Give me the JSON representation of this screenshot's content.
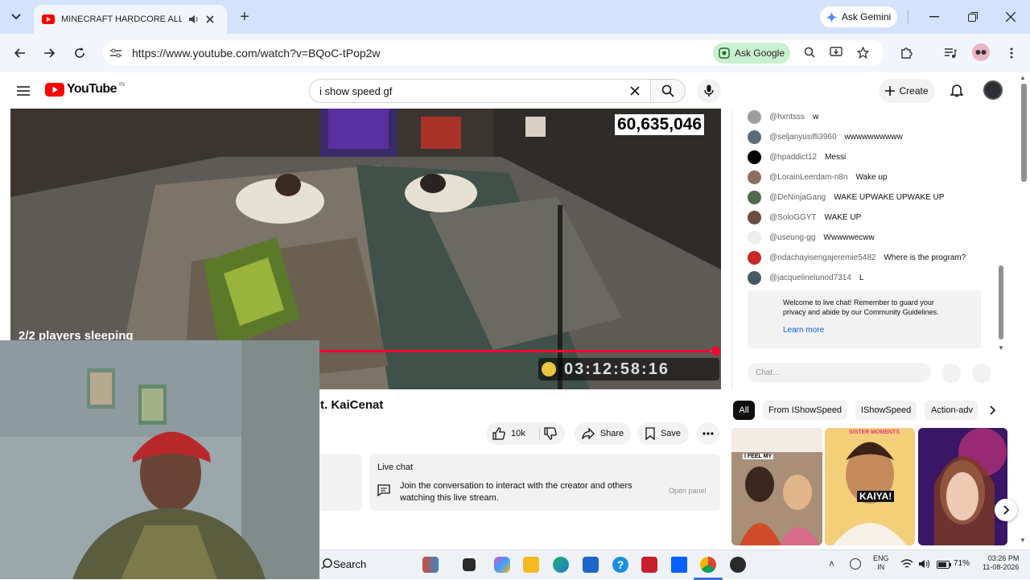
{
  "browser": {
    "tab_title": "MINECRAFT HARDCORE ALL BOS",
    "new_tab": "+",
    "ask_gemini": "Ask Gemini",
    "url": "https://www.youtube.com/watch?v=BQoC-tPop2w",
    "ask_google": "Ask Google"
  },
  "youtube": {
    "logo_text": "YouTube",
    "country_code": "IN",
    "search_value": "i show speed gf",
    "create_label": "Create"
  },
  "video": {
    "counter": "60,635,046",
    "overlay_text": "2/2 players sleeping",
    "timer": "03:12:58:16",
    "progress_fraction": 0.99,
    "title": "t. KaiCenat"
  },
  "actions": {
    "like_count": "10k",
    "share_label": "Share",
    "save_label": "Save"
  },
  "live_chat_panel": {
    "heading": "Live chat",
    "body": "Join the conversation to interact with the creator and others watching this live stream.",
    "open_button": "Open panel"
  },
  "chat": {
    "messages": [
      {
        "user": "@hxntsss",
        "text": "w",
        "color": "#9e9e9e"
      },
      {
        "user": "@seljanyusifli3960",
        "text": "wwwwwwwwww",
        "color": "#5b6b7a"
      },
      {
        "user": "@hpaddict12",
        "text": "Messi",
        "color": "#000000"
      },
      {
        "user": "@LorainLeerdam-n8n",
        "text": "Wake up",
        "color": "#8d6e63"
      },
      {
        "user": "@DeNinjaGang",
        "text": "WAKE UPWAKE UPWAKE UP",
        "color": "#4e6b4a"
      },
      {
        "user": "@SoloGGYT",
        "text": "WAKE UP",
        "color": "#6d4c41"
      },
      {
        "user": "@useung-gg",
        "text": "Wwwwwecww",
        "color": "#eeeeee"
      },
      {
        "user": "@ndachayisengajeremie5482",
        "text": "Where is the program?",
        "color": "#c62828"
      },
      {
        "user": "@jacquelinelunod7314",
        "text": "L",
        "color": "#455a64"
      }
    ],
    "welcome": "Welcome to live chat! Remember to guard your privacy and abide by our Community Guidelines.",
    "learn_more": "Learn more",
    "input_placeholder": "Chat..."
  },
  "chips": [
    "All",
    "From IShowSpeed",
    "IShowSpeed",
    "Action-adv"
  ],
  "thumb_text": [
    "I FEEL MY",
    "KAIYA!",
    "SISTER MOMENTS"
  ],
  "taskbar": {
    "search_label": "Search",
    "lang_top": "ENG",
    "lang_bottom": "IN",
    "battery": "71%",
    "time": "03:26 PM",
    "date": "11-08-2026"
  },
  "colors": {
    "youtube_red": "#ff0000",
    "progress": "#ff0033",
    "link_blue": "#065fd4",
    "tabbar": "#d3e3fd"
  }
}
